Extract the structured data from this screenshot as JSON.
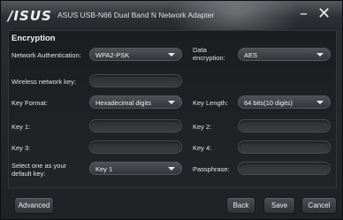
{
  "window": {
    "logo": "/ISUS",
    "title": "ASUS USB-N66 Dual Band N Network Adapter",
    "minimize": "–",
    "close": "✕"
  },
  "section": {
    "title": "Encryption"
  },
  "form": {
    "network_auth_label": "Network Authentication:",
    "network_auth_value": "WPA2-PSK",
    "data_encryption_label": "Data encryption:",
    "data_encryption_value": "AES",
    "wireless_key_label": "Wireless network key:",
    "wireless_key_value": "",
    "key_format_label": "Key Format:",
    "key_format_value": "Hexadecimal digits",
    "key_length_label": "Key Length:",
    "key_length_value": "64 bits(10 digits)",
    "key1_label": "Key 1:",
    "key1_value": "",
    "key2_label": "Key 2:",
    "key2_value": "",
    "key3_label": "Key 3:",
    "key3_value": "",
    "key4_label": "Key 4:",
    "key4_value": "",
    "default_key_label": "Select one as your default key:",
    "default_key_value": "Key 1",
    "passphrase_label": "Passphrase:",
    "passphrase_value": ""
  },
  "footer": {
    "advanced": "Advanced",
    "back": "Back",
    "save": "Save",
    "cancel": "Cancel"
  }
}
